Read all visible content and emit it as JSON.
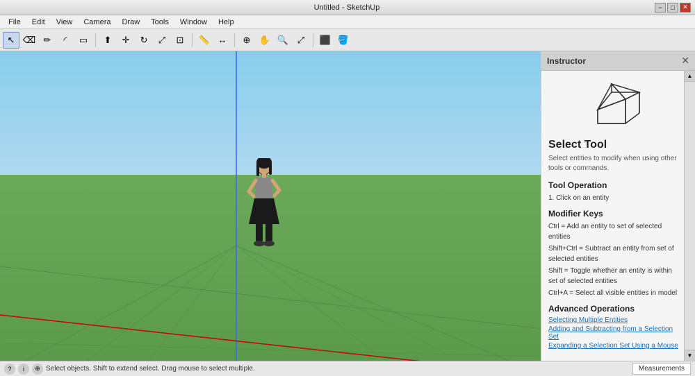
{
  "titlebar": {
    "title": "Untitled - SketchUp",
    "min_label": "−",
    "max_label": "□",
    "close_label": "✕"
  },
  "menubar": {
    "items": [
      "File",
      "Edit",
      "View",
      "Camera",
      "Draw",
      "Tools",
      "Window",
      "Help"
    ]
  },
  "toolbar": {
    "tools": [
      {
        "name": "select",
        "icon": "↖",
        "active": true
      },
      {
        "name": "eraser",
        "icon": "⌫",
        "active": false
      },
      {
        "name": "pencil",
        "icon": "✏",
        "active": false
      },
      {
        "name": "arc",
        "icon": "◜",
        "active": false
      },
      {
        "name": "rect",
        "icon": "▭",
        "active": false
      },
      {
        "name": "sep1",
        "type": "sep"
      },
      {
        "name": "push-pull",
        "icon": "⬆",
        "active": false
      },
      {
        "name": "move",
        "icon": "✛",
        "active": false
      },
      {
        "name": "rotate",
        "icon": "↻",
        "active": false
      },
      {
        "name": "scale",
        "icon": "⤢",
        "active": false
      },
      {
        "name": "offset",
        "icon": "⊡",
        "active": false
      },
      {
        "name": "sep2",
        "type": "sep"
      },
      {
        "name": "tape",
        "icon": "📏",
        "active": false
      },
      {
        "name": "dimension",
        "icon": "↔",
        "active": false
      },
      {
        "name": "sep3",
        "type": "sep"
      },
      {
        "name": "orbit",
        "icon": "⊕",
        "active": false
      },
      {
        "name": "pan",
        "icon": "✋",
        "active": false
      },
      {
        "name": "zoom",
        "icon": "🔍",
        "active": false
      },
      {
        "name": "zoom-extent",
        "icon": "⤢",
        "active": false
      },
      {
        "name": "sep4",
        "type": "sep"
      },
      {
        "name": "component",
        "icon": "⬛",
        "active": false
      },
      {
        "name": "paint",
        "icon": "🪣",
        "active": false
      }
    ]
  },
  "instructor": {
    "title": "Instructor",
    "close_icon": "✕",
    "scroll_up": "▲",
    "scroll_down": "▼",
    "tool_name": "Select Tool",
    "tool_description": "Select entities to modify when using other tools or commands.",
    "sections": [
      {
        "key": "tool_operation",
        "title": "Tool Operation",
        "content": "1.   Click on an entity"
      },
      {
        "key": "modifier_keys",
        "title": "Modifier Keys",
        "content": "Ctrl = Add an entity to set of selected entities\nShift+Ctrl = Subtract an entity from set of selected entities\nShift = Toggle whether an entity is within set of selected entities\nCtrl+A = Select all visible entities in model"
      },
      {
        "key": "advanced_operations",
        "title": "Advanced Operations",
        "links": [
          "Selecting Multiple Entities",
          "Adding and Subtracting from a Selection Set",
          "Expanding a Selection Set Using a Mouse"
        ]
      }
    ]
  },
  "statusbar": {
    "status_text": "Select objects. Shift to extend select. Drag mouse to select multiple.",
    "measurements_label": "Measurements",
    "icons": [
      "?",
      "i",
      "⊕"
    ]
  },
  "canvas": {
    "grid_color": "#cc0000",
    "axis_color_vertical": "#3366ff",
    "axis_color_diagonal": "#cc0000",
    "ground_color": "#5a9a4a",
    "sky_color": "#87ceeb"
  }
}
